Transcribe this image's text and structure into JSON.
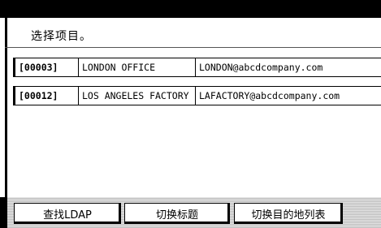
{
  "header": {
    "prompt": "选择项目。"
  },
  "entries": [
    {
      "id": "[00003]",
      "name": "LONDON OFFICE",
      "email": "LONDON@abcdcompany.com"
    },
    {
      "id": "[00012]",
      "name": "LOS ANGELES FACTORY",
      "email": "LAFACTORY@abcdcompany.com"
    }
  ],
  "buttons": {
    "search_ldap": "查找LDAP",
    "switch_title": "切换标题",
    "switch_destination_list": "切换目的地列表"
  },
  "colors": {
    "background": "#ffffff",
    "frame": "#000000",
    "bottom_bar": "#d0d0d0"
  }
}
